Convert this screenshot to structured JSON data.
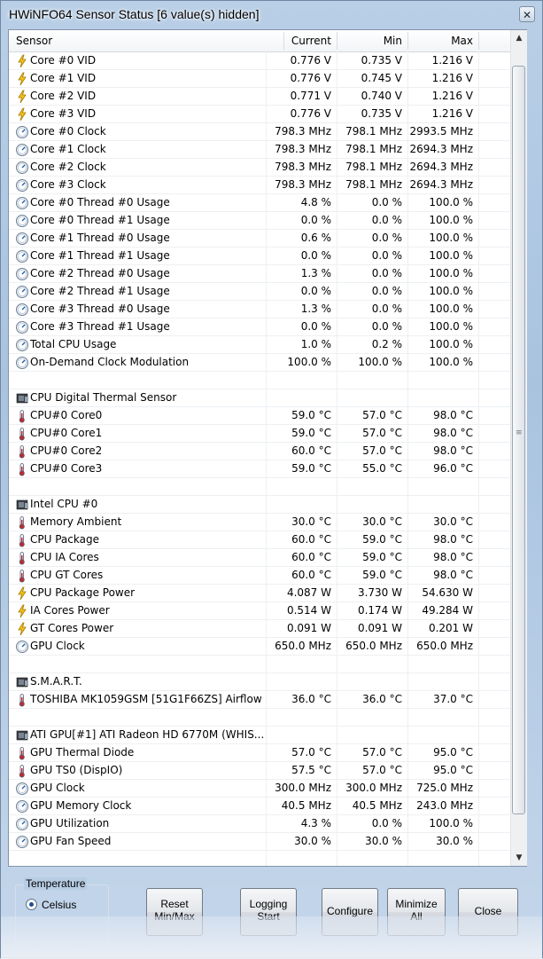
{
  "window": {
    "title": "HWiNFO64 Sensor Status [6 value(s) hidden]",
    "close_glyph": "✕"
  },
  "columns": {
    "sensor": "Sensor",
    "current": "Current",
    "min": "Min",
    "max": "Max"
  },
  "rows": [
    {
      "icon": "voltage-icon",
      "name": "Core #0 VID",
      "current": "0.776 V",
      "min": "0.735 V",
      "max": "1.216 V"
    },
    {
      "icon": "voltage-icon",
      "name": "Core #1 VID",
      "current": "0.776 V",
      "min": "0.745 V",
      "max": "1.216 V"
    },
    {
      "icon": "voltage-icon",
      "name": "Core #2 VID",
      "current": "0.771 V",
      "min": "0.740 V",
      "max": "1.216 V"
    },
    {
      "icon": "voltage-icon",
      "name": "Core #3 VID",
      "current": "0.776 V",
      "min": "0.735 V",
      "max": "1.216 V"
    },
    {
      "icon": "clock-icon",
      "name": "Core #0 Clock",
      "current": "798.3 MHz",
      "min": "798.1 MHz",
      "max": "2993.5 MHz"
    },
    {
      "icon": "clock-icon",
      "name": "Core #1 Clock",
      "current": "798.3 MHz",
      "min": "798.1 MHz",
      "max": "2694.3 MHz"
    },
    {
      "icon": "clock-icon",
      "name": "Core #2 Clock",
      "current": "798.3 MHz",
      "min": "798.1 MHz",
      "max": "2694.3 MHz"
    },
    {
      "icon": "clock-icon",
      "name": "Core #3 Clock",
      "current": "798.3 MHz",
      "min": "798.1 MHz",
      "max": "2694.3 MHz"
    },
    {
      "icon": "clock-icon",
      "name": "Core #0 Thread #0 Usage",
      "current": "4.8 %",
      "min": "0.0 %",
      "max": "100.0 %"
    },
    {
      "icon": "clock-icon",
      "name": "Core #0 Thread #1 Usage",
      "current": "0.0 %",
      "min": "0.0 %",
      "max": "100.0 %"
    },
    {
      "icon": "clock-icon",
      "name": "Core #1 Thread #0 Usage",
      "current": "0.6 %",
      "min": "0.0 %",
      "max": "100.0 %"
    },
    {
      "icon": "clock-icon",
      "name": "Core #1 Thread #1 Usage",
      "current": "0.0 %",
      "min": "0.0 %",
      "max": "100.0 %"
    },
    {
      "icon": "clock-icon",
      "name": "Core #2 Thread #0 Usage",
      "current": "1.3 %",
      "min": "0.0 %",
      "max": "100.0 %"
    },
    {
      "icon": "clock-icon",
      "name": "Core #2 Thread #1 Usage",
      "current": "0.0 %",
      "min": "0.0 %",
      "max": "100.0 %"
    },
    {
      "icon": "clock-icon",
      "name": "Core #3 Thread #0 Usage",
      "current": "1.3 %",
      "min": "0.0 %",
      "max": "100.0 %"
    },
    {
      "icon": "clock-icon",
      "name": "Core #3 Thread #1 Usage",
      "current": "0.0 %",
      "min": "0.0 %",
      "max": "100.0 %"
    },
    {
      "icon": "clock-icon",
      "name": "Total CPU Usage",
      "current": "1.0 %",
      "min": "0.2 %",
      "max": "100.0 %"
    },
    {
      "icon": "clock-icon",
      "name": "On-Demand Clock Modulation",
      "current": "100.0 %",
      "min": "100.0 %",
      "max": "100.0 %"
    },
    {
      "icon": "",
      "name": "",
      "current": "",
      "min": "",
      "max": ""
    },
    {
      "icon": "chip-icon",
      "name": "CPU Digital Thermal Sensor",
      "current": "",
      "min": "",
      "max": ""
    },
    {
      "icon": "thermometer-icon",
      "name": "CPU#0 Core0",
      "current": "59.0 °C",
      "min": "57.0 °C",
      "max": "98.0 °C"
    },
    {
      "icon": "thermometer-icon",
      "name": "CPU#0 Core1",
      "current": "59.0 °C",
      "min": "57.0 °C",
      "max": "98.0 °C"
    },
    {
      "icon": "thermometer-icon",
      "name": "CPU#0 Core2",
      "current": "60.0 °C",
      "min": "57.0 °C",
      "max": "98.0 °C"
    },
    {
      "icon": "thermometer-icon",
      "name": "CPU#0 Core3",
      "current": "59.0 °C",
      "min": "55.0 °C",
      "max": "96.0 °C"
    },
    {
      "icon": "",
      "name": "",
      "current": "",
      "min": "",
      "max": ""
    },
    {
      "icon": "chip-icon",
      "name": "Intel CPU #0",
      "current": "",
      "min": "",
      "max": ""
    },
    {
      "icon": "thermometer-icon",
      "name": "Memory Ambient",
      "current": "30.0 °C",
      "min": "30.0 °C",
      "max": "30.0 °C"
    },
    {
      "icon": "thermometer-icon",
      "name": "CPU Package",
      "current": "60.0 °C",
      "min": "59.0 °C",
      "max": "98.0 °C"
    },
    {
      "icon": "thermometer-icon",
      "name": "CPU IA Cores",
      "current": "60.0 °C",
      "min": "59.0 °C",
      "max": "98.0 °C"
    },
    {
      "icon": "thermometer-icon",
      "name": "CPU GT Cores",
      "current": "60.0 °C",
      "min": "59.0 °C",
      "max": "98.0 °C"
    },
    {
      "icon": "voltage-icon",
      "name": "CPU Package Power",
      "current": "4.087 W",
      "min": "3.730 W",
      "max": "54.630 W"
    },
    {
      "icon": "voltage-icon",
      "name": "IA Cores Power",
      "current": "0.514 W",
      "min": "0.174 W",
      "max": "49.284 W"
    },
    {
      "icon": "voltage-icon",
      "name": "GT Cores Power",
      "current": "0.091 W",
      "min": "0.091 W",
      "max": "0.201 W"
    },
    {
      "icon": "clock-icon",
      "name": "GPU Clock",
      "current": "650.0 MHz",
      "min": "650.0 MHz",
      "max": "650.0 MHz"
    },
    {
      "icon": "",
      "name": "",
      "current": "",
      "min": "",
      "max": ""
    },
    {
      "icon": "chip-icon",
      "name": "S.M.A.R.T.",
      "current": "",
      "min": "",
      "max": ""
    },
    {
      "icon": "thermometer-icon",
      "name": "TOSHIBA MK1059GSM [51G1F66ZS] Airflow",
      "current": "36.0 °C",
      "min": "36.0 °C",
      "max": "37.0 °C"
    },
    {
      "icon": "",
      "name": "",
      "current": "",
      "min": "",
      "max": ""
    },
    {
      "icon": "chip-icon",
      "name": "ATI GPU[#1] ATI Radeon HD 6770M (WHIS...",
      "current": "",
      "min": "",
      "max": ""
    },
    {
      "icon": "thermometer-icon",
      "name": "GPU Thermal Diode",
      "current": "57.0 °C",
      "min": "57.0 °C",
      "max": "95.0 °C"
    },
    {
      "icon": "thermometer-icon",
      "name": "GPU TS0 (DispIO)",
      "current": "57.5 °C",
      "min": "57.0 °C",
      "max": "95.0 °C"
    },
    {
      "icon": "clock-icon",
      "name": "GPU Clock",
      "current": "300.0 MHz",
      "min": "300.0 MHz",
      "max": "725.0 MHz"
    },
    {
      "icon": "clock-icon",
      "name": "GPU Memory Clock",
      "current": "40.5 MHz",
      "min": "40.5 MHz",
      "max": "243.0 MHz"
    },
    {
      "icon": "clock-icon",
      "name": "GPU Utilization",
      "current": "4.3 %",
      "min": "0.0 %",
      "max": "100.0 %"
    },
    {
      "icon": "clock-icon",
      "name": "GPU Fan Speed",
      "current": "30.0 %",
      "min": "30.0 %",
      "max": "30.0 %"
    }
  ],
  "scrollbar": {
    "up_glyph": "▲",
    "down_glyph": "▼",
    "grip_glyph": "≡"
  },
  "temperature": {
    "group_label": "Temperature",
    "selected_option": "Celsius"
  },
  "buttons": {
    "reset": "Reset Min/Max",
    "logging": "Logging Start",
    "configure": "Configure",
    "minimize": "Minimize All",
    "close": "Close"
  }
}
